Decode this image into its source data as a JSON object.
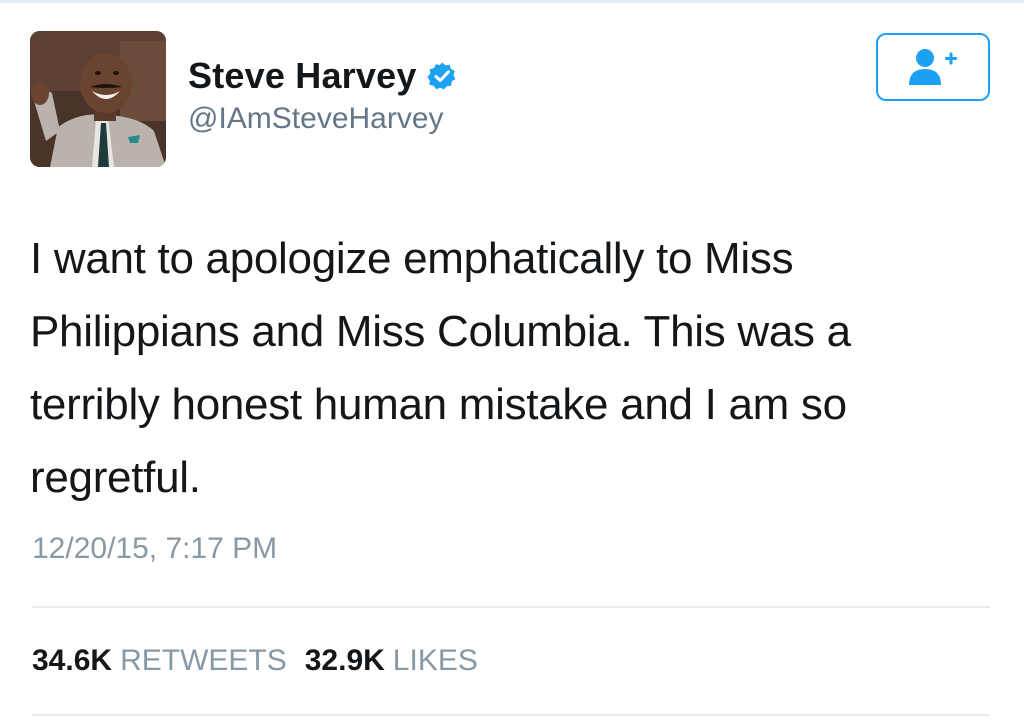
{
  "user": {
    "display_name": "Steve Harvey",
    "handle": "@IAmSteveHarvey",
    "verified": true,
    "avatar_icon": "profile-photo",
    "verified_icon": "verified-badge-icon"
  },
  "follow_button": {
    "icon": "follow-user-plus-icon",
    "color": "#1da1f2"
  },
  "tweet": {
    "lines": [
      "I want to apologize emphatically to Miss",
      "Philippians and Miss Columbia. This was a",
      "terribly honest human mistake and I am so",
      "regretful."
    ],
    "timestamp": "12/20/15, 7:17 PM"
  },
  "stats": {
    "retweets_count": "34.6K",
    "retweets_label": "RETWEETS",
    "likes_count": "32.9K",
    "likes_label": "LIKES"
  },
  "colors": {
    "text": "#14171a",
    "secondary": "#657786",
    "muted": "#8899a6",
    "accent": "#1da1f2",
    "divider": "#e6ecf0"
  }
}
